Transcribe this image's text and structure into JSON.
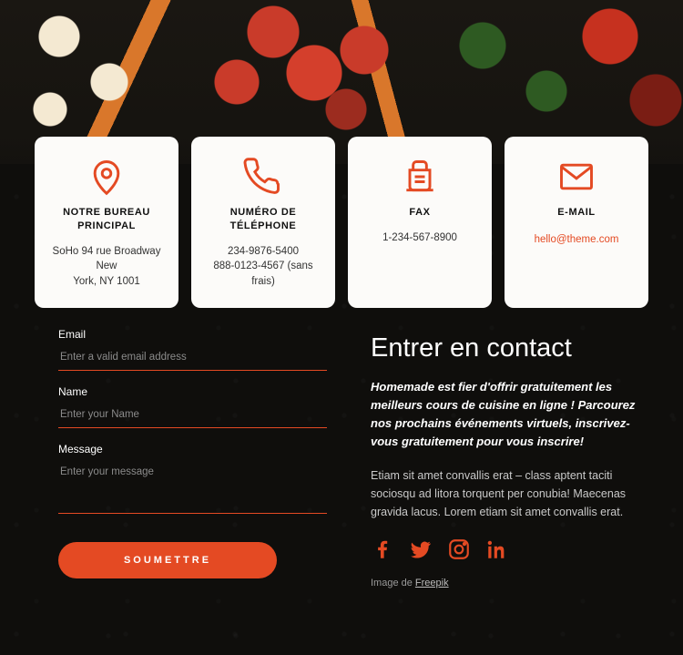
{
  "cards": [
    {
      "title": "NOTRE BUREAU PRINCIPAL",
      "line1": "SoHo 94 rue Broadway New",
      "line2": "York, NY 1001"
    },
    {
      "title": "NUMÉRO DE TÉLÉPHONE",
      "line1": "234-9876-5400",
      "line2": "888-0123-4567 (sans frais)"
    },
    {
      "title": "FAX",
      "line1": "1-234-567-8900",
      "line2": ""
    },
    {
      "title": "E-MAIL",
      "link": "hello@theme.com"
    }
  ],
  "form": {
    "emailLabel": "Email",
    "emailPlaceholder": "Enter a valid email address",
    "nameLabel": "Name",
    "namePlaceholder": "Enter your Name",
    "messageLabel": "Message",
    "messagePlaceholder": "Enter your message",
    "submit": "SOUMETTRE"
  },
  "text": {
    "heading": "Entrer en contact",
    "intro": "Homemade est fier d'offrir gratuitement les meilleurs cours de cuisine en ligne ! Parcourez nos prochains événements virtuels, inscrivez-vous gratuitement pour vous inscrire!",
    "body": "Etiam sit amet convallis erat – class aptent taciti sociosqu ad litora torquent per conubia! Maecenas gravida lacus. Lorem etiam sit amet convallis erat.",
    "creditPrefix": "Image de ",
    "creditLink": "Freepik"
  }
}
